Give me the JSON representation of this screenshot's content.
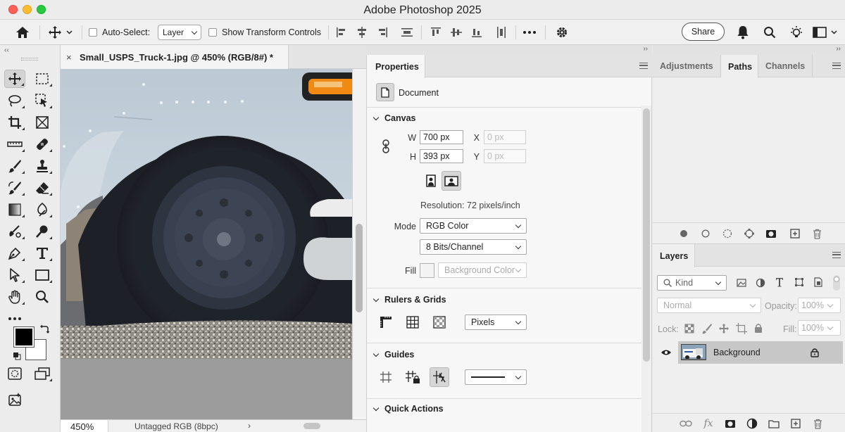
{
  "app": {
    "title": "Adobe Photoshop 2025"
  },
  "options_bar": {
    "auto_select_label": "Auto-Select:",
    "auto_select_value": "Layer",
    "show_transform_label": "Show Transform Controls",
    "share_label": "Share"
  },
  "document": {
    "tab_title": "Small_USPS_Truck-1.jpg @ 450% (RGB/8#) *",
    "close_glyph": "×",
    "zoom": "450%",
    "color_profile": "Untagged RGB (8bpc)",
    "status_arrow": "›"
  },
  "properties": {
    "tab_label": "Properties",
    "context": "Document",
    "canvas": {
      "heading": "Canvas",
      "w_label": "W",
      "w_value": "700 px",
      "h_label": "H",
      "h_value": "393 px",
      "x_label": "X",
      "x_value": "0 px",
      "y_label": "Y",
      "y_value": "0 px",
      "resolution": "Resolution: 72 pixels/inch",
      "mode_label": "Mode",
      "mode_value": "RGB Color",
      "bits_value": "8 Bits/Channel",
      "fill_label": "Fill",
      "fill_value": "Background Color"
    },
    "rulers": {
      "heading": "Rulers & Grids",
      "units_value": "Pixels"
    },
    "guides": {
      "heading": "Guides"
    },
    "quick_actions": {
      "heading": "Quick Actions"
    }
  },
  "right_top": {
    "tabs": [
      {
        "label": "Adjustments"
      },
      {
        "label": "Paths"
      },
      {
        "label": "Channels"
      }
    ]
  },
  "layers": {
    "tab_label": "Layers",
    "filter_kind": "Kind",
    "blend_mode": "Normal",
    "opacity_label": "Opacity:",
    "opacity_value": "100%",
    "lock_label": "Lock:",
    "fill_label": "Fill:",
    "fill_value": "100%",
    "items": [
      {
        "name": "Background"
      }
    ]
  },
  "colors": {
    "foreground": "#000000",
    "background": "#ffffff",
    "accent_orange": "#f08a14"
  }
}
